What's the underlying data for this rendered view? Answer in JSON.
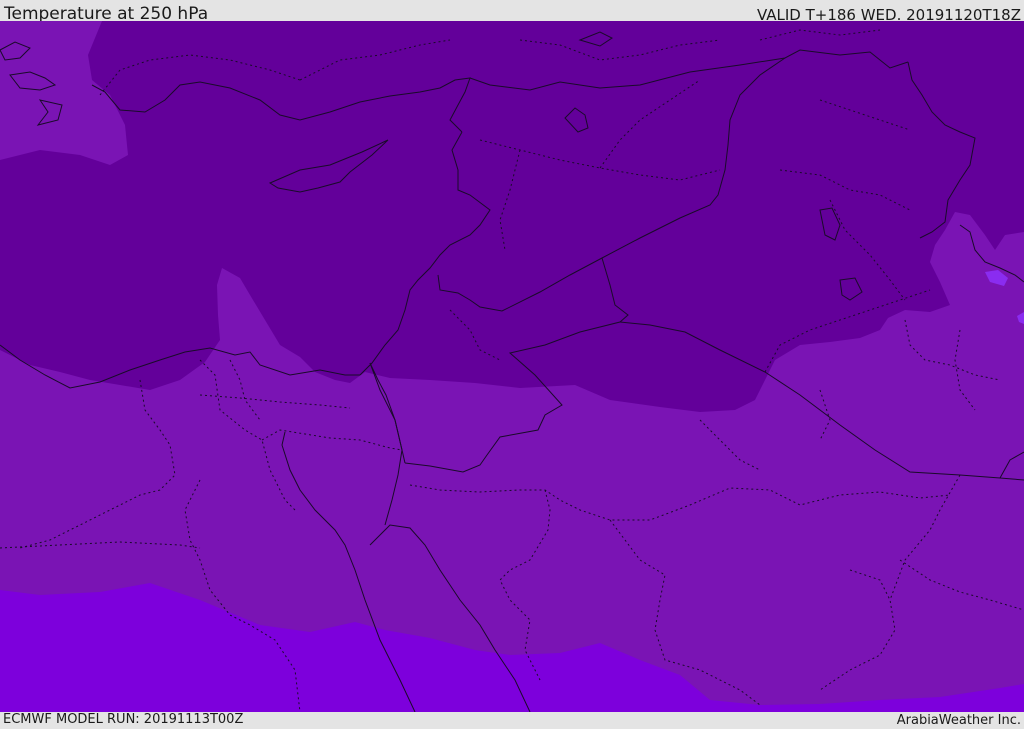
{
  "header": {
    "title": "Temperature at 250 hPa",
    "valid_time": "VALID T+186 WED. 20191120T18Z"
  },
  "footer": {
    "model_run": "ECMWF MODEL RUN: 20191113T00Z",
    "credit": "ArabiaWeather Inc."
  },
  "map": {
    "field": "Temperature at 250 hPa",
    "shading_colors": {
      "coldest": "#63009a",
      "cold": "#7a14b4",
      "mild": "#7d00dc",
      "spot": "#8a2cf0"
    },
    "border_color": "#1a0a2a"
  }
}
